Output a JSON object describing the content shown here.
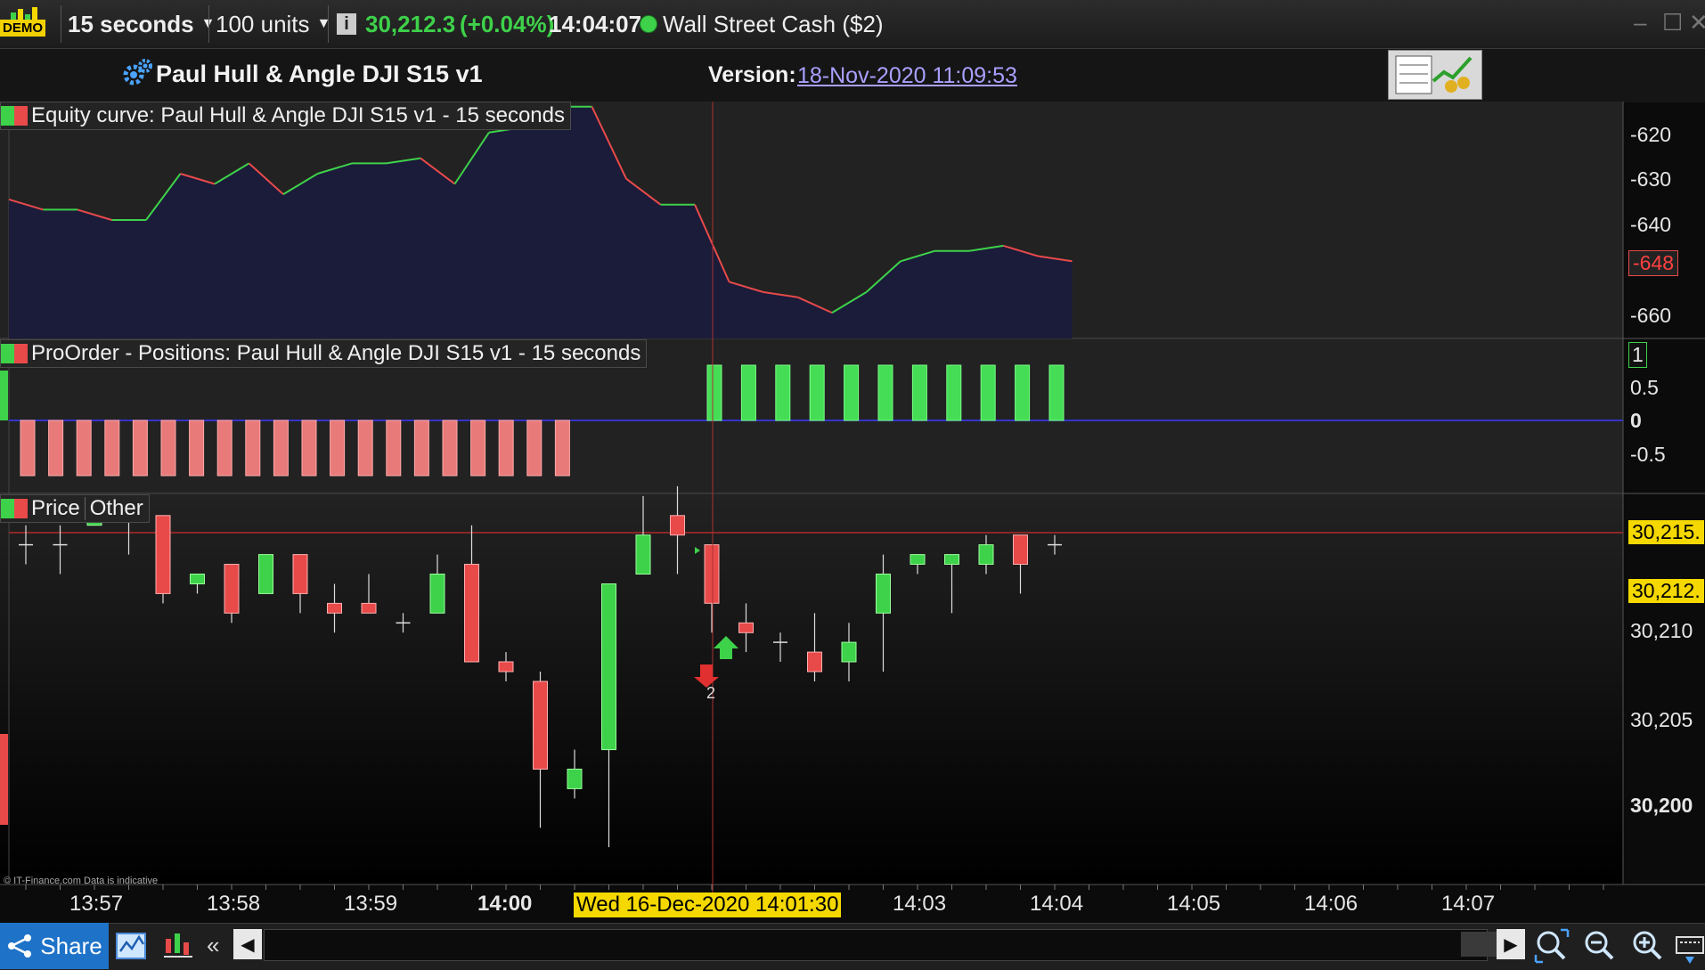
{
  "toolbar": {
    "demo_label": "DEMO",
    "timeframe": "15 seconds",
    "units": "100 units",
    "price": "30,212.3",
    "change": "(+0.04%)",
    "time": "14:04:07",
    "instrument": "Wall Street Cash ($2)"
  },
  "header": {
    "strategy_title": "Paul Hull & Angle DJI S15 v1",
    "version_label": "Version:",
    "version_value": "18-Nov-2020 11:09:53"
  },
  "equity_panel": {
    "title": "Equity curve: Paul Hull & Angle DJI S15 v1 - 15 seconds",
    "y_ticks": [
      "-620",
      "-630",
      "-640",
      "-660"
    ],
    "current_value": "-648"
  },
  "positions_panel": {
    "title": "ProOrder - Positions: Paul Hull & Angle DJI S15 v1 - 15 seconds",
    "y_ticks": [
      "1",
      "0.5",
      "0",
      "-0.5"
    ]
  },
  "price_panel": {
    "tab_price": "Price",
    "tab_other": "Other",
    "y_ticks": [
      "30,210",
      "30,205",
      "30,200"
    ],
    "badge_top": "30,215.",
    "badge_current": "30,212.",
    "trade_count": "2",
    "footer": "© IT-Finance.com Data is indicative"
  },
  "x_axis": {
    "ticks": [
      "13:57",
      "13:58",
      "13:59",
      "14:00",
      "14:03",
      "14:04",
      "14:05",
      "14:06",
      "14:07"
    ],
    "cursor_label": "Wed 16-Dec-2020 14:01:30"
  },
  "bottombar": {
    "share_label": "Share"
  },
  "colors": {
    "up": "#3ed14a",
    "down": "#e84a4a",
    "equity_fill": "#1b1b3a",
    "badge_yellow": "#f4d800"
  },
  "chart_data": [
    {
      "type": "line",
      "series": [
        {
          "values": [
            -636,
            -638,
            -638,
            -640,
            -640,
            -631,
            -633,
            -629,
            -635,
            -631,
            -629,
            -629,
            -628,
            -633,
            -623,
            -622,
            -618,
            -618,
            -632,
            -637,
            -637,
            -652,
            -654,
            -655,
            -658,
            -654,
            -648,
            -646,
            -646,
            -645,
            -647,
            -648
          ]
        }
      ],
      "ylim": [
        -663,
        -617
      ]
    },
    {
      "type": "bar",
      "values": [
        -1,
        -1,
        -1,
        -1,
        -1,
        -1,
        -1,
        -1,
        -1,
        -1,
        -1,
        -1,
        -1,
        -1,
        -1,
        -1,
        -1,
        -1,
        -1,
        -1,
        1,
        1,
        1,
        1,
        1,
        1,
        1,
        1,
        1,
        1,
        1
      ],
      "ylim": [
        -1,
        1
      ]
    },
    {
      "type": "candlestick",
      "ylim": [
        30196,
        30216
      ],
      "candles": [
        {
          "o": 30212.5,
          "h": 30213.5,
          "l": 30211.5,
          "c": 30212.5
        },
        {
          "o": 30212.5,
          "h": 30213.5,
          "l": 30211,
          "c": 30212.5
        },
        {
          "o": 30213.5,
          "h": 30214.5,
          "l": 30213.5,
          "c": 30214
        },
        {
          "o": 30214.5,
          "h": 30214.5,
          "l": 30212,
          "c": 30214
        },
        {
          "o": 30214,
          "h": 30214,
          "l": 30209.5,
          "c": 30210
        },
        {
          "o": 30210.5,
          "h": 30211,
          "l": 30210,
          "c": 30211
        },
        {
          "o": 30211.5,
          "h": 30211.5,
          "l": 30208.5,
          "c": 30209
        },
        {
          "o": 30210,
          "h": 30212,
          "l": 30210,
          "c": 30212
        },
        {
          "o": 30212,
          "h": 30212,
          "l": 30209,
          "c": 30210
        },
        {
          "o": 30209.5,
          "h": 30210.5,
          "l": 30208,
          "c": 30209
        },
        {
          "o": 30209.5,
          "h": 30211,
          "l": 30209,
          "c": 30209
        },
        {
          "o": 30208.5,
          "h": 30209,
          "l": 30208,
          "c": 30208.5
        },
        {
          "o": 30209,
          "h": 30212,
          "l": 30209,
          "c": 30211
        },
        {
          "o": 30211.5,
          "h": 30213.5,
          "l": 30206.5,
          "c": 30206.5
        },
        {
          "o": 30206.5,
          "h": 30207,
          "l": 30205.5,
          "c": 30206
        },
        {
          "o": 30205.5,
          "h": 30206,
          "l": 30198,
          "c": 30201
        },
        {
          "o": 30200,
          "h": 30202,
          "l": 30199.5,
          "c": 30201
        },
        {
          "o": 30202,
          "h": 30210.5,
          "l": 30197,
          "c": 30210.5
        },
        {
          "o": 30211,
          "h": 30215,
          "l": 30211,
          "c": 30213
        },
        {
          "o": 30214,
          "h": 30215.5,
          "l": 30211,
          "c": 30213
        },
        {
          "o": 30212.5,
          "h": 30212.5,
          "l": 30208,
          "c": 30209.5
        },
        {
          "o": 30208.5,
          "h": 30209.5,
          "l": 30207,
          "c": 30208
        },
        {
          "o": 30207.5,
          "h": 30208,
          "l": 30206.5,
          "c": 30207.5
        },
        {
          "o": 30207,
          "h": 30209,
          "l": 30205.5,
          "c": 30206
        },
        {
          "o": 30206.5,
          "h": 30208.5,
          "l": 30205.5,
          "c": 30207.5
        },
        {
          "o": 30209,
          "h": 30212,
          "l": 30206,
          "c": 30211
        },
        {
          "o": 30211.5,
          "h": 30212,
          "l": 30211,
          "c": 30212
        },
        {
          "o": 30211.5,
          "h": 30212,
          "l": 30209,
          "c": 30212
        },
        {
          "o": 30211.5,
          "h": 30213,
          "l": 30211,
          "c": 30212.5
        },
        {
          "o": 30213,
          "h": 30213,
          "l": 30210,
          "c": 30211.5
        },
        {
          "o": 30212.5,
          "h": 30213,
          "l": 30212,
          "c": 30212.5
        }
      ]
    }
  ]
}
